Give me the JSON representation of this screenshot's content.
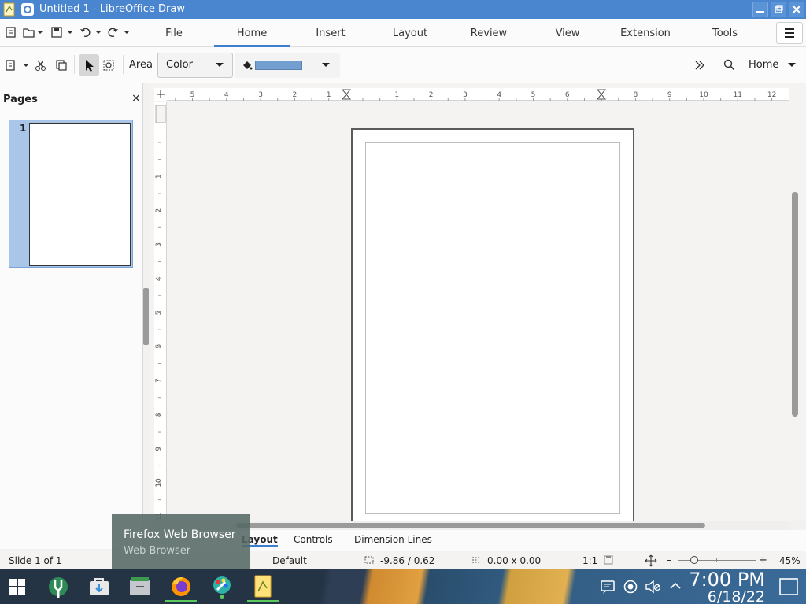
{
  "window": {
    "title": "Untitled 1 - LibreOffice Draw"
  },
  "menu": {
    "tabs": [
      "File",
      "Home",
      "Insert",
      "Layout",
      "Review",
      "View",
      "Extension",
      "Tools"
    ],
    "active_tab": "Home"
  },
  "toolbar": {
    "area_label": "Area",
    "area_fill_type": "Color",
    "fill_color": "#729fcf",
    "home_label": "Home"
  },
  "pages_panel": {
    "title": "Pages",
    "close": "×",
    "thumb_number": "1"
  },
  "rulers": {
    "horizontal_ticks": [
      "5",
      "4",
      "3",
      "2",
      "1",
      "1",
      "2",
      "3",
      "4",
      "5",
      "6",
      "7",
      "8",
      "9",
      "10",
      "11",
      "12"
    ],
    "vertical_ticks": [
      "1",
      "2",
      "3",
      "4",
      "5",
      "6",
      "7",
      "8",
      "9",
      "10",
      "11"
    ]
  },
  "layer_tabs": [
    "Layout",
    "Controls",
    "Dimension Lines"
  ],
  "status": {
    "slide": "Slide 1 of 1",
    "master": "Default",
    "position": "-9.86 / 0.62",
    "size": "0.00 x 0.00",
    "scale": "1:1",
    "zoom": "45%"
  },
  "tooltip": {
    "title": "Firefox Web Browser",
    "subtitle": "Web Browser"
  },
  "taskbar": {
    "time": "7:00 PM",
    "date": "6/18/22",
    "apps": [
      "start-menu",
      "system-settings",
      "discover",
      "file-manager",
      "firefox",
      "kolourpaint",
      "libreoffice-draw"
    ]
  },
  "colors": {
    "titlebar": "#4a86cf",
    "accent": "#3b80d0",
    "active_indicator": "#59c95c"
  }
}
